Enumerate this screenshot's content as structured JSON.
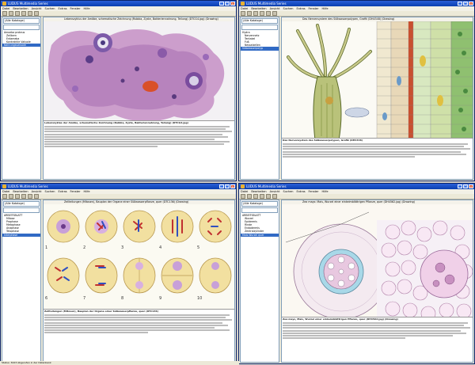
{
  "common": {
    "menu": [
      "Datei",
      "Bearbeiten",
      "Ansicht",
      "Suchen",
      "Extras",
      "Fenster",
      "Hilfe"
    ],
    "catalog_select": "(Alle Kataloge)"
  },
  "windows": [
    {
      "id": "amoeba",
      "title": "LUDUS Multimedia Series",
      "image_title": "Lebenszyklus der Amöbe, schematische Zeichnung (Rubbia, Zyste, Bakteriennahrung, Teilung) (DTCG4.jpg) (Drawing)",
      "caption_title": "Lebenszyklus der Amöbe, schematische Zeichnung (Rubbia, Zyste, Bakteriennahrung, Teilung) (DTCG4.jpg)",
      "tree": [
        {
          "t": "Amoeba proteus",
          "c": "b"
        },
        {
          "t": "Zellkern",
          "c": "i"
        },
        {
          "t": "Entameba",
          "c": "i"
        },
        {
          "t": "Kontraktile Vakuole",
          "c": "i"
        },
        {
          "t": "Nahrungsvakuole",
          "c": "hl"
        }
      ],
      "colors": {
        "accent": "#316ac5"
      }
    },
    {
      "id": "hydra",
      "title": "LUDUS Multimedia Series",
      "image_title": "Das Nervensystem des Süßwasserpolypen, Grafik (DH4348) (Drawing)",
      "caption_title": "Das Nervensystem des Süßwasserpolypen, Grafik (DH4348)",
      "tree": [
        {
          "t": "Hydra",
          "c": "b"
        },
        {
          "t": "Nervennetz",
          "c": "i"
        },
        {
          "t": "Tentakel",
          "c": "i"
        },
        {
          "t": "Fuß",
          "c": "i"
        },
        {
          "t": "Nesselzellen",
          "c": "i"
        },
        {
          "t": "Süßwasserpolyp",
          "c": "hl"
        }
      ],
      "colors": {
        "accent": "#316ac5"
      }
    },
    {
      "id": "mitosis",
      "title": "LUDUS Multimedia Series",
      "image_title": "Zellteilungen (Mitosen), Bauplan der Organe einer Süßwasserpflanze, quer (DTC136) (Drawing)",
      "caption_title": "Zellteilungen (Mitosen), Bauplan der Organe einer Süßwasserpflanze, quer (DTC136)",
      "tree": [
        {
          "t": "ARBEITSBLATT",
          "c": "b"
        },
        {
          "t": "Mitose",
          "c": "i"
        },
        {
          "t": "Prophase",
          "c": "i"
        },
        {
          "t": "Metaphase",
          "c": "i"
        },
        {
          "t": "Anaphase",
          "c": "i"
        },
        {
          "t": "Telophase",
          "c": "i"
        },
        {
          "t": "Interphase",
          "c": "hl"
        }
      ],
      "numbers": [
        "1",
        "2",
        "3",
        "4",
        "5",
        "6",
        "7",
        "8",
        "9",
        "10"
      ],
      "colors": {
        "accent": "#316ac5"
      }
    },
    {
      "id": "root",
      "title": "LUDUS Multimedia Series",
      "image_title": "Zea mays: Mais, Wurzel einer einkeimblättrigen Pflanze, quer (DH4562.jpg) (Drawing)",
      "caption_title": "Zea mays, Mais, Wurzel einer einkeimblättrigen Pflanze, quer (DH4562.jpg) (Drawing)",
      "tree": [
        {
          "t": "ARBEITSBLATT",
          "c": "b"
        },
        {
          "t": "Wurzel",
          "c": "i"
        },
        {
          "t": "Epidermis",
          "c": "i"
        },
        {
          "t": "Rinde",
          "c": "i"
        },
        {
          "t": "Endodermis",
          "c": "i"
        },
        {
          "t": "Zentralzylinder",
          "c": "i"
        },
        {
          "t": "Mais Wurzel quer",
          "c": "hl"
        }
      ],
      "colors": {
        "accent": "#316ac5"
      }
    }
  ],
  "status": "Status: 3423 Abgerufen in der Datenbank"
}
